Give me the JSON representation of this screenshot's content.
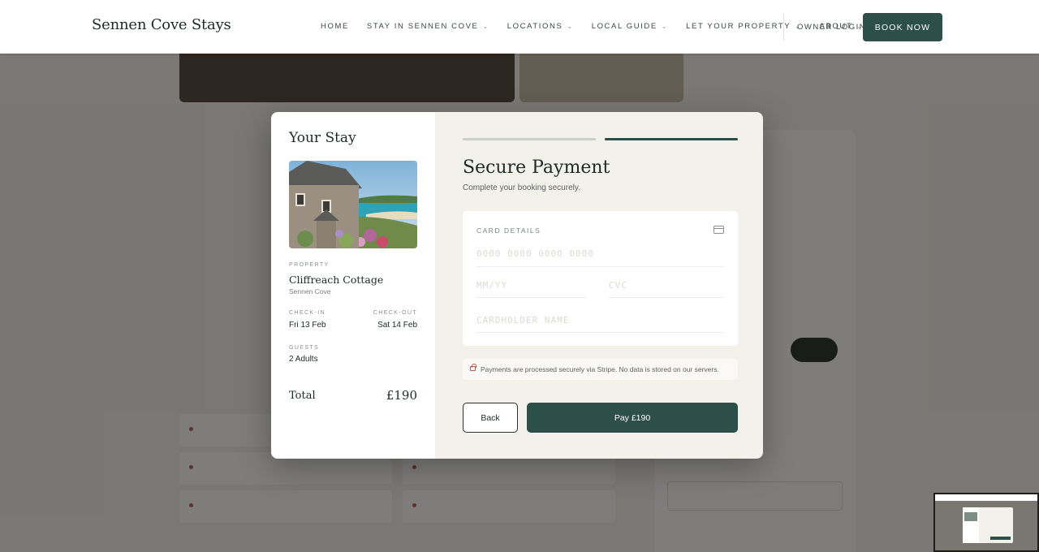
{
  "header": {
    "brand": "Sennen Cove Stays",
    "nav": [
      {
        "label": "HOME",
        "has_dropdown": false
      },
      {
        "label": "STAY IN SENNEN COVE",
        "has_dropdown": true
      },
      {
        "label": "LOCATIONS",
        "has_dropdown": true
      },
      {
        "label": "LOCAL GUIDE",
        "has_dropdown": true
      },
      {
        "label": "LET YOUR PROPERTY",
        "has_dropdown": true
      },
      {
        "label": "ABOUT",
        "has_dropdown": true
      }
    ],
    "owner_login": "OWNER LOGIN",
    "book_now": "BOOK NOW"
  },
  "modal": {
    "summary": {
      "heading": "Your Stay",
      "property_label": "PROPERTY",
      "property_name": "Cliffreach Cottage",
      "property_location": "Sennen Cove",
      "checkin_label": "CHECK-IN",
      "checkin_value": "Fri 13 Feb",
      "checkout_label": "CHECK-OUT",
      "checkout_value": "Sat 14 Feb",
      "guests_label": "GUESTS",
      "guests_value": "2 Adults",
      "total_label": "Total",
      "total_value": "£190"
    },
    "payment": {
      "current_step": 2,
      "total_steps": 2,
      "heading": "Secure Payment",
      "subheading": "Complete your booking securely.",
      "card_details_label": "CARD DETAILS",
      "card_number_placeholder": "0000  0000  0000  0000",
      "expiry_placeholder": "MM/YY",
      "cvc_placeholder": "CVC",
      "name_placeholder": "CARDHOLDER NAME",
      "secure_note": "Payments are processed securely via Stripe. No data is stored on our servers.",
      "back_label": "Back",
      "pay_label": "Pay £190"
    },
    "close_icon": "×"
  },
  "colors": {
    "brand_green": "#2c4f4a",
    "panel_bg": "#f3f1ec",
    "accent_red": "#b65a4a"
  }
}
